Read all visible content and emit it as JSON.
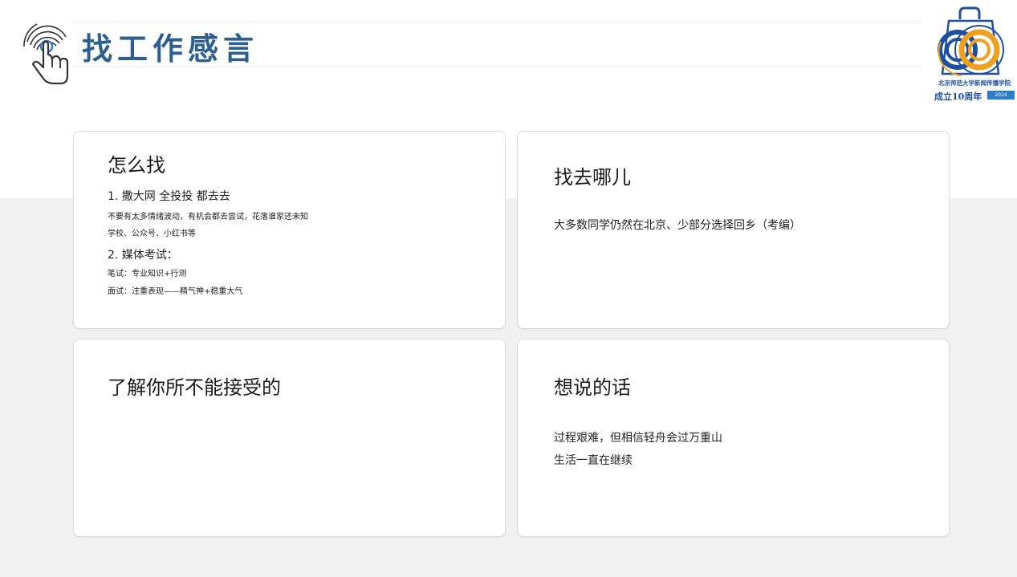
{
  "header": {
    "title": "找工作感言"
  },
  "logo": {
    "line1": "北京师范大学新闻传播学院",
    "line2": "成立10周年",
    "badge": "2024"
  },
  "cards": {
    "how": {
      "title": "怎么找",
      "lines": [
        "1. 撒大网  全投投  都去去",
        "不要有太多情绪波动，有机会都去尝试，花落谁家还未知",
        "学校、公众号、小红书等",
        "2. 媒体考试：",
        "笔试：专业知识+行测",
        "面试：注重表现——精气神+稳重大气"
      ]
    },
    "where": {
      "title": "找去哪儿",
      "lines": [
        "大多数同学仍然在北京、少部分选择回乡（考编）"
      ]
    },
    "unacceptable": {
      "title": "了解你所不能接受的",
      "lines": []
    },
    "words": {
      "title": "想说的话",
      "lines": [
        "过程艰难，但相信轻舟会过万重山",
        "生活一直在继续"
      ]
    }
  },
  "colors": {
    "title": "#2f5f8f",
    "logo_blue": "#1f4fa0",
    "logo_orange": "#f0a020",
    "band": "#f1f1f1"
  },
  "icons": {
    "header": "hand-pointer-icon",
    "logo": "anniversary-logo"
  }
}
